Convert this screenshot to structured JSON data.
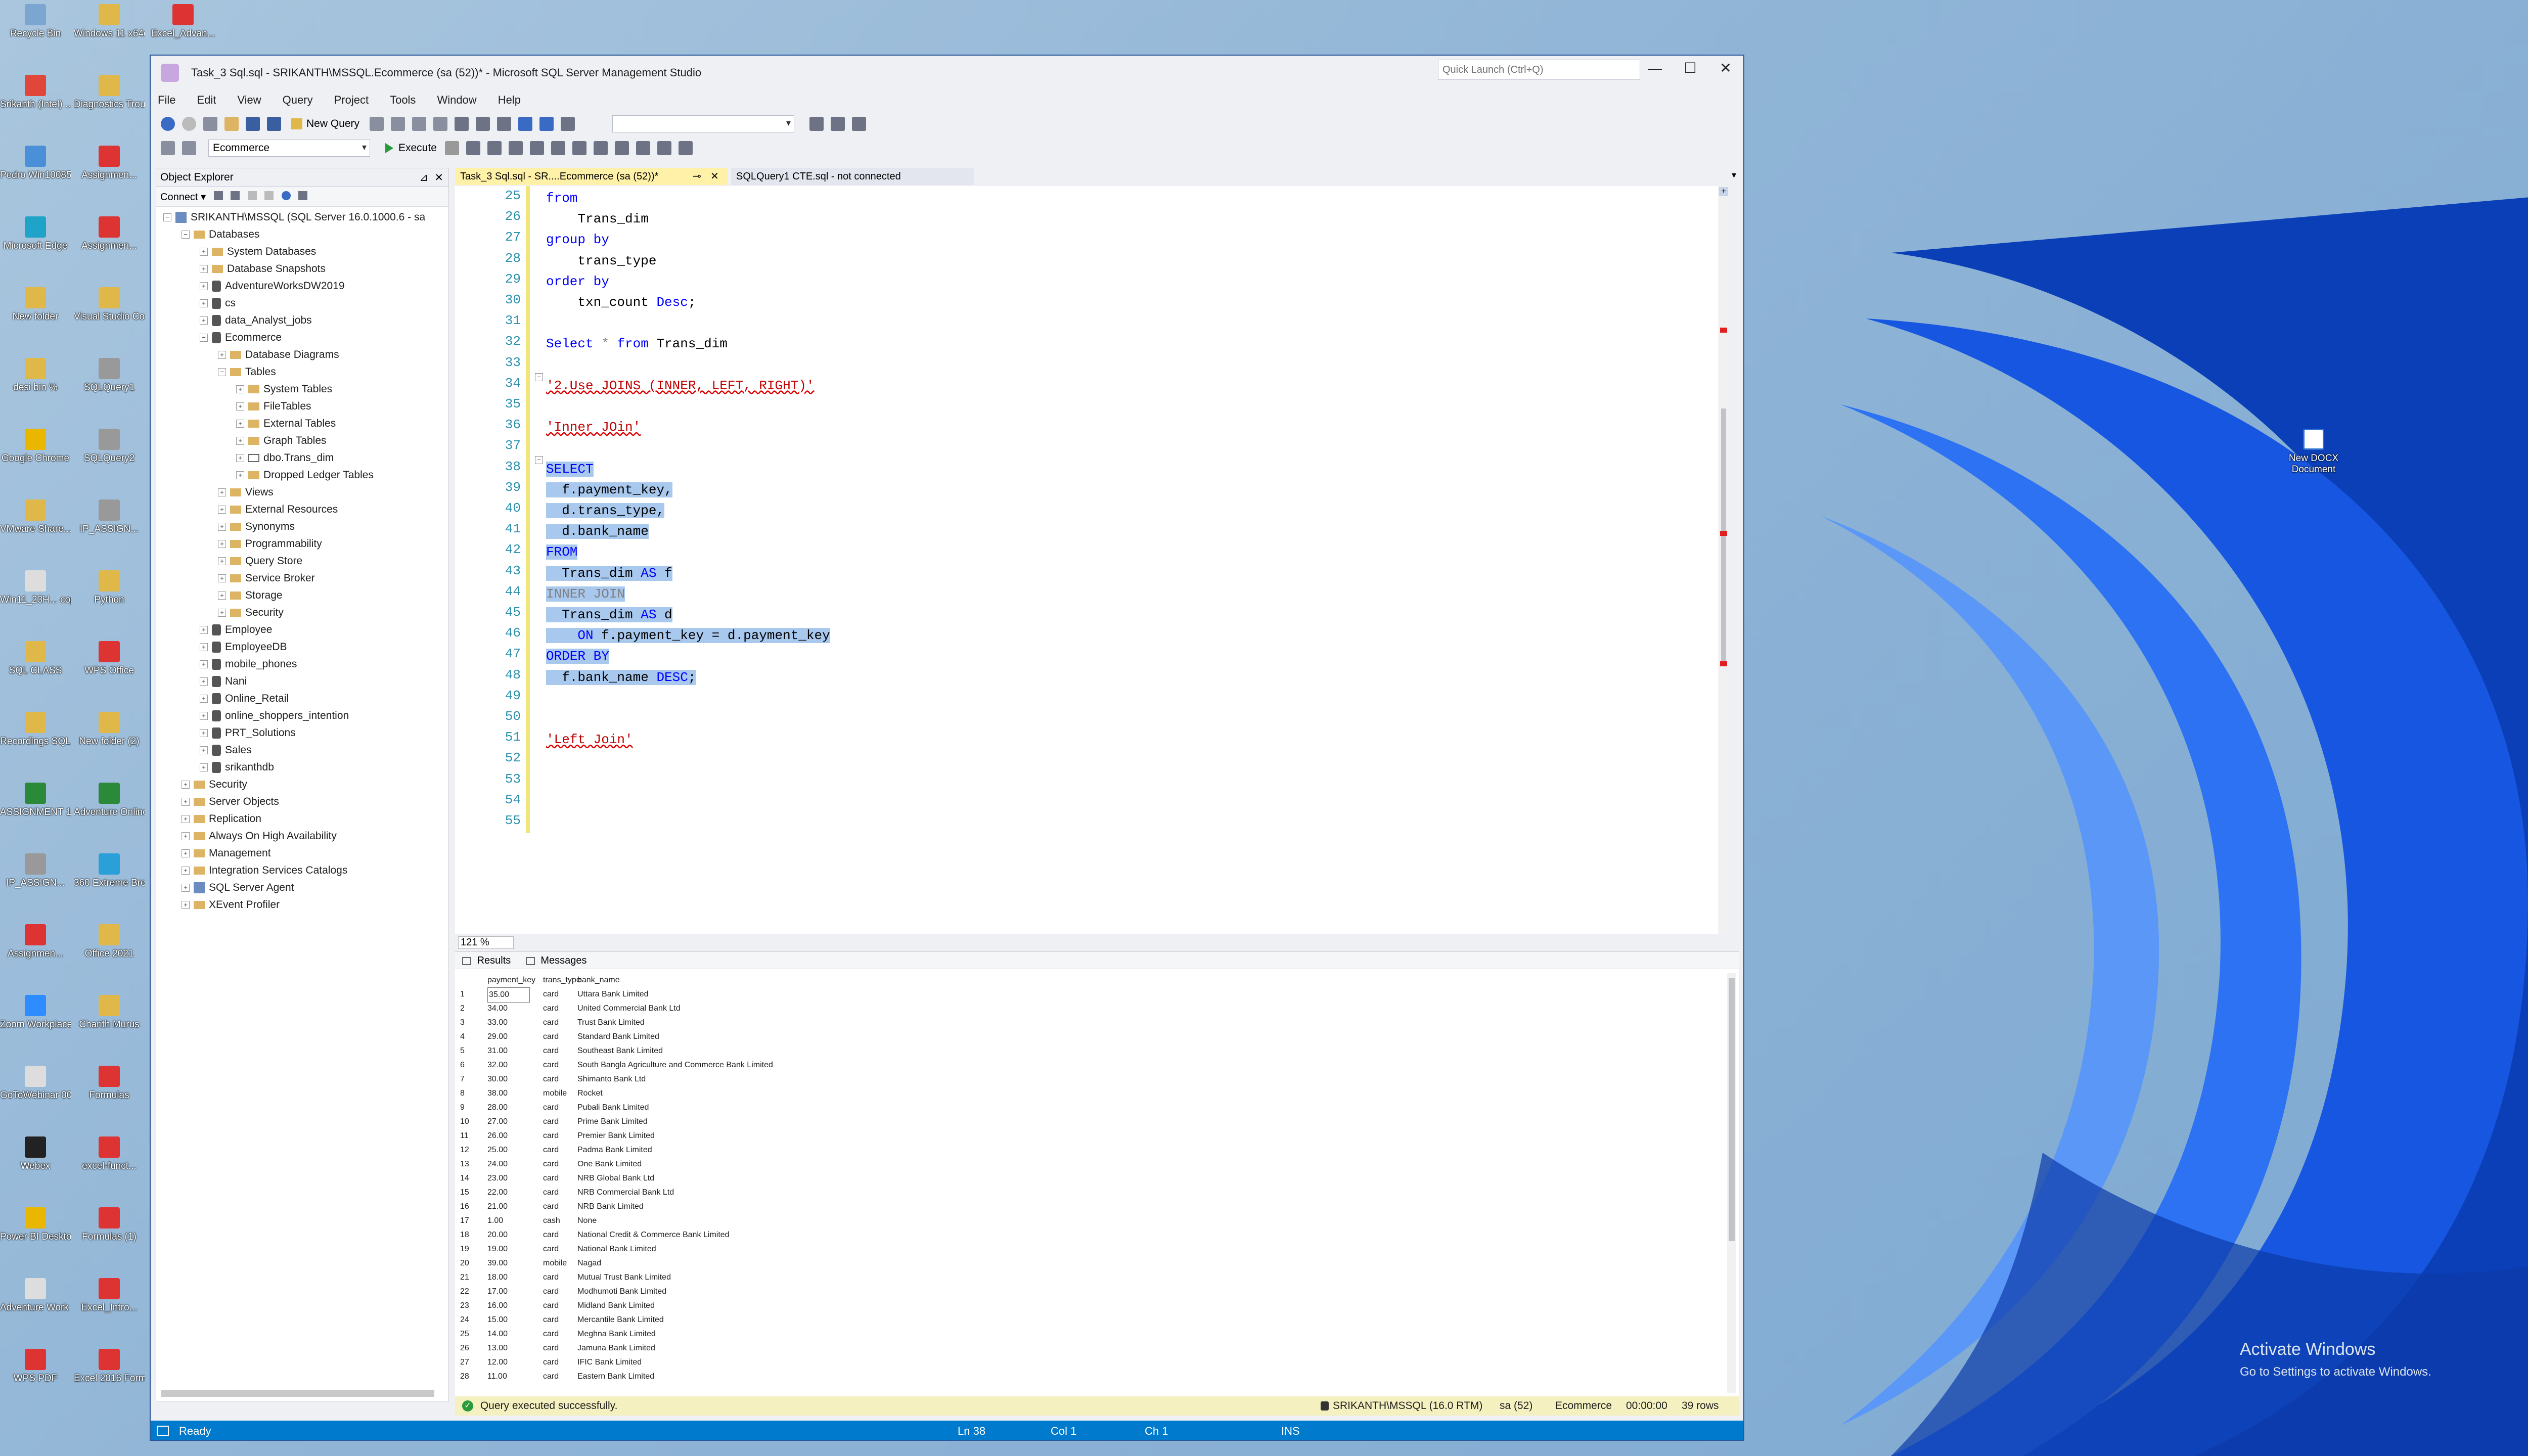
{
  "desktop": {
    "left_icons": [
      {
        "label": "Recycle Bin",
        "color": "#7aa6d0"
      },
      {
        "label": "Windows 11 x64dreamar...",
        "color": "#e0b84a"
      },
      {
        "label": "Excel_Advan...",
        "color": "#d33"
      },
      {
        "label": "Srikanth (Intel) ...",
        "color": "#e0463a"
      },
      {
        "label": "Diagnostics Troubleshoo...",
        "color": "#e0b84a"
      },
      {
        "label": "Pedro Win10085",
        "color": "#4a90d9"
      },
      {
        "label": "Assignmen...",
        "color": "#d33"
      },
      {
        "label": "Microsoft Edge",
        "color": "#1fa3c8"
      },
      {
        "label": "Assignmen...",
        "color": "#d33"
      },
      {
        "label": "New folder",
        "color": "#e0b84a"
      },
      {
        "label": "Visual Studio Code — Wi...",
        "color": "#e0b84a"
      },
      {
        "label": "desi bin %",
        "color": "#e0b84a"
      },
      {
        "label": "SQLQuery1",
        "color": "#999"
      },
      {
        "label": "Google Chrome",
        "color": "#e9b600"
      },
      {
        "label": "SQLQuery2",
        "color": "#999"
      },
      {
        "label": "VMware Share...",
        "color": "#e0b84a"
      },
      {
        "label": "IP_ASSIGN...",
        "color": "#999"
      },
      {
        "label": "Win11_23H... copy",
        "color": "#ddd"
      },
      {
        "label": "Python",
        "color": "#e0b84a"
      },
      {
        "label": "SQL CLASS",
        "color": "#e0b84a"
      },
      {
        "label": "WPS Office",
        "color": "#d33"
      },
      {
        "label": "Recordings SQL",
        "color": "#e0b84a"
      },
      {
        "label": "New folder (2)",
        "color": "#e0b84a"
      },
      {
        "label": "ASSIGNMENT 1_IP",
        "color": "#2a8a3a"
      },
      {
        "label": "Adventure Online Sales",
        "color": "#2a8a3a"
      },
      {
        "label": "IP_ASSIGN...",
        "color": "#999"
      },
      {
        "label": "360 Extreme Browser",
        "color": "#2aa0d8"
      },
      {
        "label": "Assignmen...",
        "color": "#d33"
      },
      {
        "label": "Office 2021",
        "color": "#e0b84a"
      },
      {
        "label": "Zoom Workplace",
        "color": "#2d8cff"
      },
      {
        "label": "Charith Murus",
        "color": "#e0b84a"
      },
      {
        "label": "GoToWebinar 000",
        "color": "#ddd"
      },
      {
        "label": "Formulas",
        "color": "#d33"
      },
      {
        "label": "Webex",
        "color": "#222"
      },
      {
        "label": "excel-funct...",
        "color": "#d33"
      },
      {
        "label": "Power BI Desktop",
        "color": "#e9b600"
      },
      {
        "label": "Formulas (1)",
        "color": "#d33"
      },
      {
        "label": "Adventure Work Sales",
        "color": "#ddd"
      },
      {
        "label": "Excel_Intro...",
        "color": "#d33"
      },
      {
        "label": "WPS PDF",
        "color": "#d33"
      },
      {
        "label": "Excel 2016 Formulas...",
        "color": "#d33"
      }
    ],
    "right_icon": {
      "label": "New DOCX Document",
      "color": "#2b6fd1"
    },
    "activation_title": "Activate Windows",
    "activation_sub": "Go to Settings to activate Windows."
  },
  "window": {
    "title": "Task_3 Sql.sql - SRIKANTH\\MSSQL.Ecommerce (sa (52))* - Microsoft SQL Server Management Studio",
    "quick_launch_placeholder": "Quick Launch (Ctrl+Q)",
    "minimize": "—",
    "maximize": "☐",
    "close": "✕",
    "menu": [
      "File",
      "Edit",
      "View",
      "Query",
      "Project",
      "Tools",
      "Window",
      "Help"
    ],
    "toolbar": {
      "new_query": "New Query",
      "database": "Ecommerce",
      "execute": "Execute"
    }
  },
  "object_explorer": {
    "title": "Object Explorer",
    "connect": "Connect",
    "tree": [
      {
        "label": "SRIKANTH\\MSSQL (SQL Server 16.0.1000.6 - sa",
        "icon": "srv",
        "exp": "−",
        "depth": 0
      },
      {
        "label": "Databases",
        "icon": "fld",
        "exp": "−",
        "depth": 1
      },
      {
        "label": "System Databases",
        "icon": "fld",
        "exp": "+",
        "depth": 2
      },
      {
        "label": "Database Snapshots",
        "icon": "fld",
        "exp": "+",
        "depth": 2
      },
      {
        "label": "AdventureWorksDW2019",
        "icon": "db",
        "exp": "+",
        "depth": 2
      },
      {
        "label": "cs",
        "icon": "db",
        "exp": "+",
        "depth": 2
      },
      {
        "label": "data_Analyst_jobs",
        "icon": "db",
        "exp": "+",
        "depth": 2
      },
      {
        "label": "Ecommerce",
        "icon": "db",
        "exp": "−",
        "depth": 2
      },
      {
        "label": "Database Diagrams",
        "icon": "fld",
        "exp": "+",
        "depth": 3
      },
      {
        "label": "Tables",
        "icon": "fld",
        "exp": "−",
        "depth": 3
      },
      {
        "label": "System Tables",
        "icon": "fld",
        "exp": "+",
        "depth": 4
      },
      {
        "label": "FileTables",
        "icon": "fld",
        "exp": "+",
        "depth": 4
      },
      {
        "label": "External Tables",
        "icon": "fld",
        "exp": "+",
        "depth": 4
      },
      {
        "label": "Graph Tables",
        "icon": "fld",
        "exp": "+",
        "depth": 4
      },
      {
        "label": "dbo.Trans_dim",
        "icon": "tbl",
        "exp": "+",
        "depth": 4
      },
      {
        "label": "Dropped Ledger Tables",
        "icon": "fld",
        "exp": "+",
        "depth": 4
      },
      {
        "label": "Views",
        "icon": "fld",
        "exp": "+",
        "depth": 3
      },
      {
        "label": "External Resources",
        "icon": "fld",
        "exp": "+",
        "depth": 3
      },
      {
        "label": "Synonyms",
        "icon": "fld",
        "exp": "+",
        "depth": 3
      },
      {
        "label": "Programmability",
        "icon": "fld",
        "exp": "+",
        "depth": 3
      },
      {
        "label": "Query Store",
        "icon": "fld",
        "exp": "+",
        "depth": 3
      },
      {
        "label": "Service Broker",
        "icon": "fld",
        "exp": "+",
        "depth": 3
      },
      {
        "label": "Storage",
        "icon": "fld",
        "exp": "+",
        "depth": 3
      },
      {
        "label": "Security",
        "icon": "fld",
        "exp": "+",
        "depth": 3
      },
      {
        "label": "Employee",
        "icon": "db",
        "exp": "+",
        "depth": 2
      },
      {
        "label": "EmployeeDB",
        "icon": "db",
        "exp": "+",
        "depth": 2
      },
      {
        "label": "mobile_phones",
        "icon": "db",
        "exp": "+",
        "depth": 2
      },
      {
        "label": "Nani",
        "icon": "db",
        "exp": "+",
        "depth": 2
      },
      {
        "label": "Online_Retail",
        "icon": "db",
        "exp": "+",
        "depth": 2
      },
      {
        "label": "online_shoppers_intention",
        "icon": "db",
        "exp": "+",
        "depth": 2
      },
      {
        "label": "PRT_Solutions",
        "icon": "db",
        "exp": "+",
        "depth": 2
      },
      {
        "label": "Sales",
        "icon": "db",
        "exp": "+",
        "depth": 2
      },
      {
        "label": "srikanthdb",
        "icon": "db",
        "exp": "+",
        "depth": 2
      },
      {
        "label": "Security",
        "icon": "fld",
        "exp": "+",
        "depth": 1
      },
      {
        "label": "Server Objects",
        "icon": "fld",
        "exp": "+",
        "depth": 1
      },
      {
        "label": "Replication",
        "icon": "fld",
        "exp": "+",
        "depth": 1
      },
      {
        "label": "Always On High Availability",
        "icon": "fld",
        "exp": "+",
        "depth": 1
      },
      {
        "label": "Management",
        "icon": "fld",
        "exp": "+",
        "depth": 1
      },
      {
        "label": "Integration Services Catalogs",
        "icon": "fld",
        "exp": "+",
        "depth": 1
      },
      {
        "label": "SQL Server Agent",
        "icon": "srv",
        "exp": "+",
        "depth": 1
      },
      {
        "label": "XEvent Profiler",
        "icon": "fld",
        "exp": "+",
        "depth": 1
      }
    ]
  },
  "tabs": [
    {
      "label": "Task_3 Sql.sql - SR....Ecommerce (sa (52))*",
      "active": true
    },
    {
      "label": "SQLQuery1 CTE.sql - not connected",
      "active": false
    }
  ],
  "editor": {
    "lines": [
      {
        "n": "25",
        "parts": [
          {
            "t": "from",
            "c": "kw"
          }
        ]
      },
      {
        "n": "26",
        "parts": [
          {
            "t": "    Trans_dim",
            "c": "pl"
          }
        ]
      },
      {
        "n": "27",
        "parts": [
          {
            "t": "group by",
            "c": "kw"
          }
        ]
      },
      {
        "n": "28",
        "parts": [
          {
            "t": "    trans_type",
            "c": "pl"
          }
        ]
      },
      {
        "n": "29",
        "parts": [
          {
            "t": "order by",
            "c": "kw"
          }
        ]
      },
      {
        "n": "30",
        "parts": [
          {
            "t": "    txn_count ",
            "c": "pl"
          },
          {
            "t": "Desc",
            "c": "kw"
          },
          {
            "t": ";",
            "c": "pl"
          }
        ]
      },
      {
        "n": "31",
        "parts": []
      },
      {
        "n": "32",
        "parts": [
          {
            "t": "Select",
            "c": "kw"
          },
          {
            "t": " * ",
            "c": "gr"
          },
          {
            "t": "from",
            "c": "kw"
          },
          {
            "t": " Trans_dim",
            "c": "pl"
          }
        ]
      },
      {
        "n": "33",
        "parts": []
      },
      {
        "n": "34",
        "parts": [
          {
            "t": "'2.Use JOINS (INNER, LEFT, RIGHT)'",
            "c": "str"
          }
        ]
      },
      {
        "n": "35",
        "parts": []
      },
      {
        "n": "36",
        "parts": [
          {
            "t": "'Inner JOin'",
            "c": "str"
          }
        ]
      },
      {
        "n": "37",
        "parts": []
      },
      {
        "n": "38",
        "parts": [
          {
            "t": "SELECT",
            "c": "kw",
            "s": 1
          }
        ]
      },
      {
        "n": "39",
        "parts": [
          {
            "t": "  f.payment_key,",
            "c": "pl",
            "s": 1
          }
        ]
      },
      {
        "n": "40",
        "parts": [
          {
            "t": "  d.trans_type,",
            "c": "pl",
            "s": 1
          }
        ]
      },
      {
        "n": "41",
        "parts": [
          {
            "t": "  d.bank_name",
            "c": "pl",
            "s": 1
          }
        ]
      },
      {
        "n": "42",
        "parts": [
          {
            "t": "FROM",
            "c": "kw",
            "s": 1
          }
        ]
      },
      {
        "n": "43",
        "parts": [
          {
            "t": "  Trans_dim ",
            "c": "pl",
            "s": 1
          },
          {
            "t": "AS",
            "c": "kw",
            "s": 1
          },
          {
            "t": " f",
            "c": "pl",
            "s": 1
          }
        ]
      },
      {
        "n": "44",
        "parts": [
          {
            "t": "INNER JOIN",
            "c": "gr",
            "s": 1
          }
        ]
      },
      {
        "n": "45",
        "parts": [
          {
            "t": "  Trans_dim ",
            "c": "pl",
            "s": 1
          },
          {
            "t": "AS",
            "c": "kw",
            "s": 1
          },
          {
            "t": " d",
            "c": "pl",
            "s": 1
          }
        ]
      },
      {
        "n": "46",
        "parts": [
          {
            "t": "    ",
            "c": "pl",
            "s": 1
          },
          {
            "t": "ON",
            "c": "kw",
            "s": 1
          },
          {
            "t": " f.payment_key = d.payment_key",
            "c": "pl",
            "s": 1
          }
        ]
      },
      {
        "n": "47",
        "parts": [
          {
            "t": "ORDER BY",
            "c": "kw",
            "s": 1
          }
        ]
      },
      {
        "n": "48",
        "parts": [
          {
            "t": "  f.bank_name ",
            "c": "pl",
            "s": 1
          },
          {
            "t": "DESC",
            "c": "kw",
            "s": 1
          },
          {
            "t": ";",
            "c": "pl",
            "s": 1
          }
        ]
      },
      {
        "n": "49",
        "parts": []
      },
      {
        "n": "50",
        "parts": []
      },
      {
        "n": "51",
        "parts": [
          {
            "t": "'Left Join'",
            "c": "str"
          }
        ]
      },
      {
        "n": "52",
        "parts": []
      },
      {
        "n": "53",
        "parts": []
      },
      {
        "n": "54",
        "parts": []
      },
      {
        "n": "55",
        "parts": []
      }
    ],
    "zoom": "121 %"
  },
  "results": {
    "tab_results": "Results",
    "tab_messages": "Messages",
    "columns": [
      "payment_key",
      "trans_type",
      "bank_name"
    ],
    "rows": [
      [
        "1",
        "35.00",
        "card",
        "Uttara Bank Limited"
      ],
      [
        "2",
        "34.00",
        "card",
        "United Commercial Bank Ltd"
      ],
      [
        "3",
        "33.00",
        "card",
        "Trust Bank Limited"
      ],
      [
        "4",
        "29.00",
        "card",
        "Standard Bank Limited"
      ],
      [
        "5",
        "31.00",
        "card",
        "Southeast Bank Limited"
      ],
      [
        "6",
        "32.00",
        "card",
        "South Bangla Agriculture and Commerce Bank Limited"
      ],
      [
        "7",
        "30.00",
        "card",
        "Shimanto Bank Ltd"
      ],
      [
        "8",
        "38.00",
        "mobile",
        "Rocket"
      ],
      [
        "9",
        "28.00",
        "card",
        "Pubali Bank Limited"
      ],
      [
        "10",
        "27.00",
        "card",
        "Prime Bank Limited"
      ],
      [
        "11",
        "26.00",
        "card",
        "Premier Bank Limited"
      ],
      [
        "12",
        "25.00",
        "card",
        "Padma Bank Limited"
      ],
      [
        "13",
        "24.00",
        "card",
        "One Bank Limited"
      ],
      [
        "14",
        "23.00",
        "card",
        "NRB Global Bank Ltd"
      ],
      [
        "15",
        "22.00",
        "card",
        "NRB Commercial Bank Ltd"
      ],
      [
        "16",
        "21.00",
        "card",
        "NRB Bank Limited"
      ],
      [
        "17",
        "1.00",
        "cash",
        "None"
      ],
      [
        "18",
        "20.00",
        "card",
        "National Credit & Commerce Bank Limited"
      ],
      [
        "19",
        "19.00",
        "card",
        "National Bank Limited"
      ],
      [
        "20",
        "39.00",
        "mobile",
        "Nagad"
      ],
      [
        "21",
        "18.00",
        "card",
        "Mutual Trust Bank Limited"
      ],
      [
        "22",
        "17.00",
        "card",
        "Modhumoti Bank Limited"
      ],
      [
        "23",
        "16.00",
        "card",
        "Midland Bank Limited"
      ],
      [
        "24",
        "15.00",
        "card",
        "Mercantile Bank Limited"
      ],
      [
        "25",
        "14.00",
        "card",
        "Meghna Bank Limited"
      ],
      [
        "26",
        "13.00",
        "card",
        "Jamuna Bank Limited"
      ],
      [
        "27",
        "12.00",
        "card",
        "IFIC Bank Limited"
      ],
      [
        "28",
        "11.00",
        "card",
        "Eastern Bank Limited"
      ]
    ]
  },
  "query_status": {
    "message": "Query executed successfully.",
    "server": "SRIKANTH\\MSSQL (16.0 RTM)",
    "user": "sa (52)",
    "db": "Ecommerce",
    "time": "00:00:00",
    "rows": "39 rows"
  },
  "statusbar": {
    "ready": "Ready",
    "ln": "Ln 38",
    "col": "Col 1",
    "ch": "Ch 1",
    "ins": "INS"
  }
}
